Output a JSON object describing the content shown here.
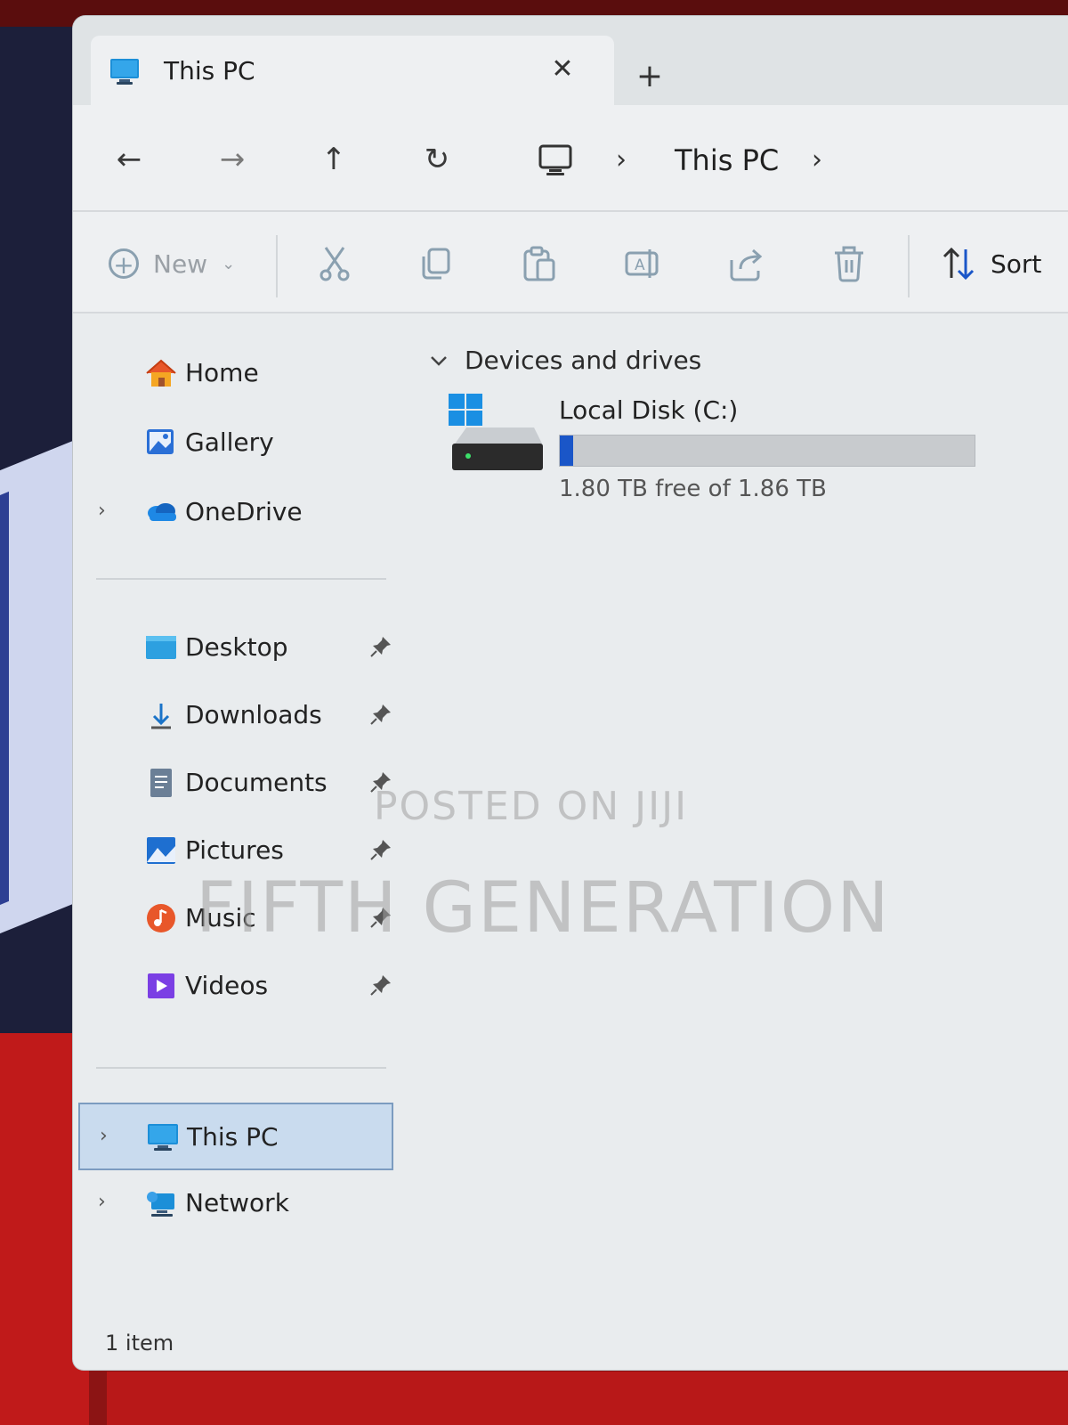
{
  "window": {
    "tab_title": "This PC",
    "close_glyph": "✕",
    "new_tab_glyph": "+"
  },
  "navigation": {
    "back_glyph": "←",
    "forward_glyph": "→",
    "up_glyph": "↑",
    "refresh_glyph": "↻",
    "breadcrumb_separator": "›",
    "breadcrumb_label": "This PC"
  },
  "command_bar": {
    "new_label": "New",
    "sort_label": "Sort",
    "icons": [
      "cut-icon",
      "copy-icon",
      "paste-icon",
      "rename-icon",
      "share-icon",
      "delete-icon"
    ]
  },
  "sidebar": {
    "home": {
      "label": "Home",
      "icon": "home-icon"
    },
    "gallery": {
      "label": "Gallery",
      "icon": "gallery-icon"
    },
    "onedrive": {
      "label": "OneDrive",
      "icon": "onedrive-icon"
    },
    "quick_access": [
      {
        "label": "Desktop",
        "icon": "desktop-folder-icon",
        "pinned": true
      },
      {
        "label": "Downloads",
        "icon": "download-icon",
        "pinned": true
      },
      {
        "label": "Documents",
        "icon": "documents-icon",
        "pinned": true
      },
      {
        "label": "Pictures",
        "icon": "pictures-icon",
        "pinned": true
      },
      {
        "label": "Music",
        "icon": "music-icon",
        "pinned": true
      },
      {
        "label": "Videos",
        "icon": "videos-icon",
        "pinned": true
      }
    ],
    "this_pc": {
      "label": "This PC",
      "icon": "computer-icon",
      "selected": true
    },
    "network": {
      "label": "Network",
      "icon": "network-icon"
    }
  },
  "main": {
    "group_header": "Devices and drives",
    "drives": [
      {
        "name": "Local Disk (C:)",
        "free_text": "1.80 TB free of 1.86 TB",
        "used_fraction": 0.032,
        "bar_color": "#1a56c8"
      }
    ]
  },
  "status_bar": {
    "item_count": "1 item"
  },
  "watermark": {
    "line1": "POSTED ON JIJI",
    "line2": "FIFTH GENERATION"
  },
  "colors": {
    "accent": "#0067c0",
    "selection": "#c9dbee"
  }
}
